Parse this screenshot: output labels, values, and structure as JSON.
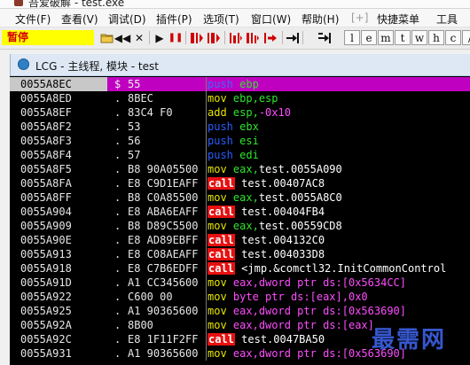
{
  "window": {
    "title": "吾爱破解 - test.exe"
  },
  "menu": {
    "items": [
      {
        "label": "文件(F)"
      },
      {
        "label": "查看(V)"
      },
      {
        "label": "调试(D)"
      },
      {
        "label": "插件(P)"
      },
      {
        "label": "选项(T)"
      },
      {
        "label": "窗口(W)"
      },
      {
        "label": "帮助(H)"
      },
      {
        "label": "[+]"
      },
      {
        "label": "快捷菜单"
      },
      {
        "label": "工具"
      }
    ]
  },
  "toolbar": {
    "status": "暂停",
    "buttons": [
      {
        "icon": "open-folder-icon"
      },
      {
        "icon": "restart-icon",
        "glyph": "◀◀"
      },
      {
        "icon": "close-icon",
        "glyph": "✕"
      },
      {
        "icon": "run-icon",
        "glyph": "▶"
      },
      {
        "icon": "pause-icon",
        "glyph": "❚❚"
      },
      {
        "icon": "step-into-icon"
      },
      {
        "icon": "step-over-icon"
      },
      {
        "icon": "trace-into-icon"
      },
      {
        "icon": "trace-over-icon"
      },
      {
        "icon": "execute-till-return-icon"
      },
      {
        "icon": "go-to-icon"
      }
    ],
    "window_letters": [
      "l",
      "e",
      "m",
      "t",
      "w",
      "h",
      "c",
      "/"
    ],
    "colors": {
      "status_bg": "#ffff00",
      "status_text": "#d40000"
    }
  },
  "subwindow": {
    "title": "LCG - 主线程, 模块 - test"
  },
  "disasm": {
    "colors": {
      "call_bg": "#e81010",
      "selected_bg": "#c000c0",
      "push": "#2a5cff",
      "mov": "#e6e600",
      "register": "#2ee52e",
      "memory": "#ff4cff"
    },
    "rows": [
      {
        "addr": "0055A8EC",
        "mark": "$",
        "hex": "55",
        "mn": "push",
        "mclass": "push",
        "ops": [
          {
            "t": "ebp",
            "c": "op-reg"
          }
        ],
        "selected": true
      },
      {
        "addr": "0055A8ED",
        "mark": ".",
        "hex": "8BEC",
        "mn": "mov",
        "mclass": "mov",
        "ops": [
          {
            "t": "ebp,esp",
            "c": "op-reg"
          }
        ]
      },
      {
        "addr": "0055A8EF",
        "mark": ".",
        "hex": "83C4 F0",
        "mn": "add",
        "mclass": "add",
        "ops": [
          {
            "t": "esp,",
            "c": "op-reg"
          },
          {
            "t": "-0x10",
            "c": "op-mag"
          }
        ]
      },
      {
        "addr": "0055A8F2",
        "mark": ".",
        "hex": "53",
        "mn": "push",
        "mclass": "push",
        "ops": [
          {
            "t": "ebx",
            "c": "op-reg"
          }
        ]
      },
      {
        "addr": "0055A8F3",
        "mark": ".",
        "hex": "56",
        "mn": "push",
        "mclass": "push",
        "ops": [
          {
            "t": "esi",
            "c": "op-reg"
          }
        ]
      },
      {
        "addr": "0055A8F4",
        "mark": ".",
        "hex": "57",
        "mn": "push",
        "mclass": "push",
        "ops": [
          {
            "t": "edi",
            "c": "op-reg"
          }
        ]
      },
      {
        "addr": "0055A8F5",
        "mark": ".",
        "hex": "B8 90A05500",
        "mn": "mov",
        "mclass": "mov",
        "ops": [
          {
            "t": "eax,",
            "c": "op-reg"
          },
          {
            "t": "test.0055A090",
            "c": "op-white"
          }
        ]
      },
      {
        "addr": "0055A8FA",
        "mark": ".",
        "hex": "E8 C9D1EAFF",
        "mn": "call",
        "mclass": "call",
        "ops": [
          {
            "t": "test.00407AC8",
            "c": "op-white"
          }
        ]
      },
      {
        "addr": "0055A8FF",
        "mark": ".",
        "hex": "B8 C0A85500",
        "mn": "mov",
        "mclass": "mov",
        "ops": [
          {
            "t": "eax,",
            "c": "op-reg"
          },
          {
            "t": "test.0055A8C0",
            "c": "op-white"
          }
        ]
      },
      {
        "addr": "0055A904",
        "mark": ".",
        "hex": "E8 ABA6EAFF",
        "mn": "call",
        "mclass": "call",
        "ops": [
          {
            "t": "test.00404FB4",
            "c": "op-white"
          }
        ]
      },
      {
        "addr": "0055A909",
        "mark": ".",
        "hex": "B8 D89C5500",
        "mn": "mov",
        "mclass": "mov",
        "ops": [
          {
            "t": "eax,",
            "c": "op-reg"
          },
          {
            "t": "test.00559CD8",
            "c": "op-white"
          }
        ]
      },
      {
        "addr": "0055A90E",
        "mark": ".",
        "hex": "E8 AD89EBFF",
        "mn": "call",
        "mclass": "call",
        "ops": [
          {
            "t": "test.004132C0",
            "c": "op-white"
          }
        ]
      },
      {
        "addr": "0055A913",
        "mark": ".",
        "hex": "E8 C08AEAFF",
        "mn": "call",
        "mclass": "call",
        "ops": [
          {
            "t": "test.004033D8",
            "c": "op-white"
          }
        ]
      },
      {
        "addr": "0055A918",
        "mark": ".",
        "hex": "E8 C7B6EDFF",
        "mn": "call",
        "mclass": "call",
        "ops": [
          {
            "t": "<jmp.&comctl32.InitCommonControl",
            "c": "op-white"
          }
        ]
      },
      {
        "addr": "0055A91D",
        "mark": ".",
        "hex": "A1 CC345600",
        "mn": "mov",
        "mclass": "mov",
        "ops": [
          {
            "t": "eax,dword ptr ds:[",
            "c": "op-mag"
          },
          {
            "t": "0x5634CC",
            "c": "op-mag"
          },
          {
            "t": "]",
            "c": "op-mag"
          }
        ]
      },
      {
        "addr": "0055A922",
        "mark": ".",
        "hex": "C600 00",
        "mn": "mov",
        "mclass": "mov",
        "ops": [
          {
            "t": "byte ptr ds:[eax],",
            "c": "op-mag"
          },
          {
            "t": "0x0",
            "c": "op-mag"
          }
        ]
      },
      {
        "addr": "0055A925",
        "mark": ".",
        "hex": "A1 90365600",
        "mn": "mov",
        "mclass": "mov",
        "ops": [
          {
            "t": "eax,dword ptr ds:[0x563690]",
            "c": "op-mag"
          }
        ]
      },
      {
        "addr": "0055A92A",
        "mark": ".",
        "hex": "8B00",
        "mn": "mov",
        "mclass": "mov",
        "ops": [
          {
            "t": "eax,dword ptr ds:[eax]",
            "c": "op-mag"
          }
        ]
      },
      {
        "addr": "0055A92C",
        "mark": ".",
        "hex": "E8 1F11F2FF",
        "mn": "call",
        "mclass": "call",
        "ops": [
          {
            "t": "test.0047BA50",
            "c": "op-white"
          }
        ]
      },
      {
        "addr": "0055A931",
        "mark": ".",
        "hex": "A1 90365600",
        "mn": "mov",
        "mclass": "mov",
        "ops": [
          {
            "t": "eax,dword ptr ds:[0x563690]",
            "c": "op-mag"
          }
        ]
      }
    ]
  },
  "watermark": {
    "text": "最需网"
  }
}
